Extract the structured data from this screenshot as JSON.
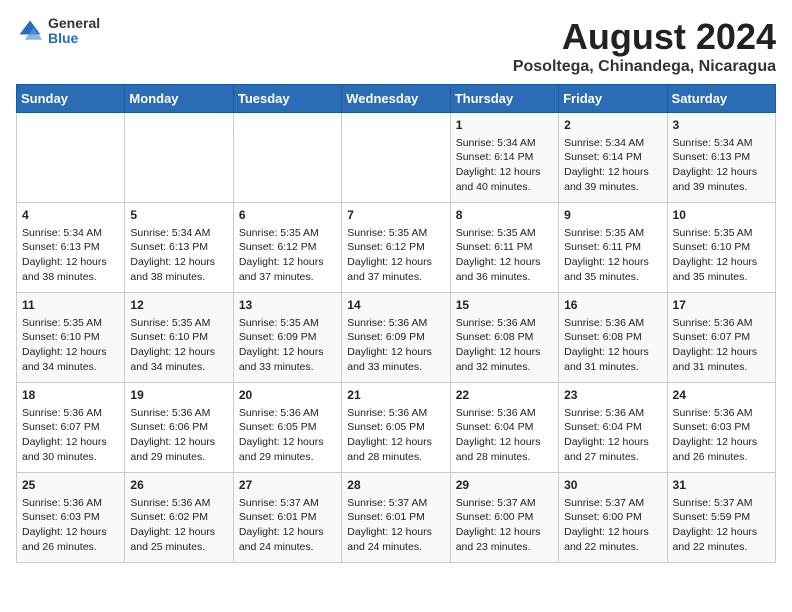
{
  "logo": {
    "general": "General",
    "blue": "Blue"
  },
  "title": "August 2024",
  "subtitle": "Posoltega, Chinandega, Nicaragua",
  "days_of_week": [
    "Sunday",
    "Monday",
    "Tuesday",
    "Wednesday",
    "Thursday",
    "Friday",
    "Saturday"
  ],
  "weeks": [
    [
      {
        "day": "",
        "content": ""
      },
      {
        "day": "",
        "content": ""
      },
      {
        "day": "",
        "content": ""
      },
      {
        "day": "",
        "content": ""
      },
      {
        "day": "1",
        "content": "Sunrise: 5:34 AM\nSunset: 6:14 PM\nDaylight: 12 hours\nand 40 minutes."
      },
      {
        "day": "2",
        "content": "Sunrise: 5:34 AM\nSunset: 6:14 PM\nDaylight: 12 hours\nand 39 minutes."
      },
      {
        "day": "3",
        "content": "Sunrise: 5:34 AM\nSunset: 6:13 PM\nDaylight: 12 hours\nand 39 minutes."
      }
    ],
    [
      {
        "day": "4",
        "content": "Sunrise: 5:34 AM\nSunset: 6:13 PM\nDaylight: 12 hours\nand 38 minutes."
      },
      {
        "day": "5",
        "content": "Sunrise: 5:34 AM\nSunset: 6:13 PM\nDaylight: 12 hours\nand 38 minutes."
      },
      {
        "day": "6",
        "content": "Sunrise: 5:35 AM\nSunset: 6:12 PM\nDaylight: 12 hours\nand 37 minutes."
      },
      {
        "day": "7",
        "content": "Sunrise: 5:35 AM\nSunset: 6:12 PM\nDaylight: 12 hours\nand 37 minutes."
      },
      {
        "day": "8",
        "content": "Sunrise: 5:35 AM\nSunset: 6:11 PM\nDaylight: 12 hours\nand 36 minutes."
      },
      {
        "day": "9",
        "content": "Sunrise: 5:35 AM\nSunset: 6:11 PM\nDaylight: 12 hours\nand 35 minutes."
      },
      {
        "day": "10",
        "content": "Sunrise: 5:35 AM\nSunset: 6:10 PM\nDaylight: 12 hours\nand 35 minutes."
      }
    ],
    [
      {
        "day": "11",
        "content": "Sunrise: 5:35 AM\nSunset: 6:10 PM\nDaylight: 12 hours\nand 34 minutes."
      },
      {
        "day": "12",
        "content": "Sunrise: 5:35 AM\nSunset: 6:10 PM\nDaylight: 12 hours\nand 34 minutes."
      },
      {
        "day": "13",
        "content": "Sunrise: 5:35 AM\nSunset: 6:09 PM\nDaylight: 12 hours\nand 33 minutes."
      },
      {
        "day": "14",
        "content": "Sunrise: 5:36 AM\nSunset: 6:09 PM\nDaylight: 12 hours\nand 33 minutes."
      },
      {
        "day": "15",
        "content": "Sunrise: 5:36 AM\nSunset: 6:08 PM\nDaylight: 12 hours\nand 32 minutes."
      },
      {
        "day": "16",
        "content": "Sunrise: 5:36 AM\nSunset: 6:08 PM\nDaylight: 12 hours\nand 31 minutes."
      },
      {
        "day": "17",
        "content": "Sunrise: 5:36 AM\nSunset: 6:07 PM\nDaylight: 12 hours\nand 31 minutes."
      }
    ],
    [
      {
        "day": "18",
        "content": "Sunrise: 5:36 AM\nSunset: 6:07 PM\nDaylight: 12 hours\nand 30 minutes."
      },
      {
        "day": "19",
        "content": "Sunrise: 5:36 AM\nSunset: 6:06 PM\nDaylight: 12 hours\nand 29 minutes."
      },
      {
        "day": "20",
        "content": "Sunrise: 5:36 AM\nSunset: 6:05 PM\nDaylight: 12 hours\nand 29 minutes."
      },
      {
        "day": "21",
        "content": "Sunrise: 5:36 AM\nSunset: 6:05 PM\nDaylight: 12 hours\nand 28 minutes."
      },
      {
        "day": "22",
        "content": "Sunrise: 5:36 AM\nSunset: 6:04 PM\nDaylight: 12 hours\nand 28 minutes."
      },
      {
        "day": "23",
        "content": "Sunrise: 5:36 AM\nSunset: 6:04 PM\nDaylight: 12 hours\nand 27 minutes."
      },
      {
        "day": "24",
        "content": "Sunrise: 5:36 AM\nSunset: 6:03 PM\nDaylight: 12 hours\nand 26 minutes."
      }
    ],
    [
      {
        "day": "25",
        "content": "Sunrise: 5:36 AM\nSunset: 6:03 PM\nDaylight: 12 hours\nand 26 minutes."
      },
      {
        "day": "26",
        "content": "Sunrise: 5:36 AM\nSunset: 6:02 PM\nDaylight: 12 hours\nand 25 minutes."
      },
      {
        "day": "27",
        "content": "Sunrise: 5:37 AM\nSunset: 6:01 PM\nDaylight: 12 hours\nand 24 minutes."
      },
      {
        "day": "28",
        "content": "Sunrise: 5:37 AM\nSunset: 6:01 PM\nDaylight: 12 hours\nand 24 minutes."
      },
      {
        "day": "29",
        "content": "Sunrise: 5:37 AM\nSunset: 6:00 PM\nDaylight: 12 hours\nand 23 minutes."
      },
      {
        "day": "30",
        "content": "Sunrise: 5:37 AM\nSunset: 6:00 PM\nDaylight: 12 hours\nand 22 minutes."
      },
      {
        "day": "31",
        "content": "Sunrise: 5:37 AM\nSunset: 5:59 PM\nDaylight: 12 hours\nand 22 minutes."
      }
    ]
  ]
}
